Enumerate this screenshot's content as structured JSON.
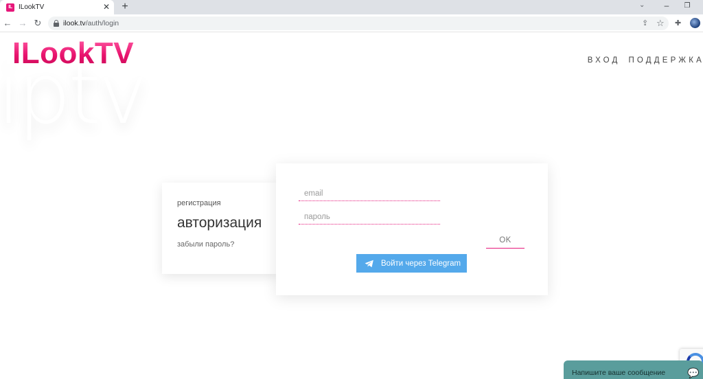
{
  "browser": {
    "tab_title": "ILookTV",
    "favicon_text": "IL",
    "url_host": "ilook.tv",
    "url_path": "/auth/login"
  },
  "header": {
    "logo": "ILookTV",
    "background_word": "iptv",
    "nav": {
      "login": "ВХОД",
      "support": "ПОДДЕРЖКА"
    }
  },
  "left_card": {
    "register_link": "регистрация",
    "title": "авторизация",
    "forgot_link": "забыли пароль?"
  },
  "form": {
    "email_placeholder": "email",
    "password_placeholder": "пароль",
    "ok_label": "OK",
    "telegram_label": "Войти через Telegram"
  },
  "chat": {
    "label": "Напишите ваше сообщение"
  },
  "colors": {
    "brand_pink": "#e6177a",
    "telegram_blue": "#54a9eb",
    "chat_teal": "#5a9d9c"
  }
}
